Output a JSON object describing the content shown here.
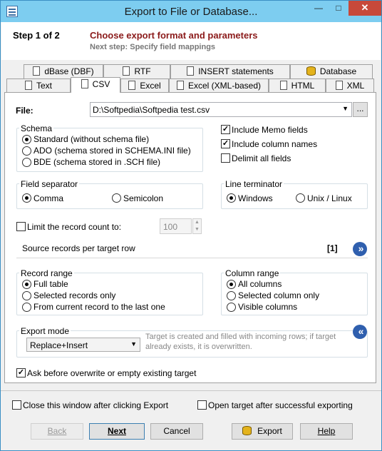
{
  "window": {
    "title": "Export to File or Database..."
  },
  "header": {
    "step": "Step 1 of 2",
    "title": "Choose export format and parameters",
    "next_step": "Next step: Specify field mappings"
  },
  "tabs_back": [
    {
      "label": "dBase (DBF)",
      "icon": "document-icon"
    },
    {
      "label": "RTF",
      "icon": "document-icon"
    },
    {
      "label": "INSERT statements",
      "icon": "document-icon"
    },
    {
      "label": "Database",
      "icon": "database-icon"
    }
  ],
  "tabs_front": [
    {
      "label": "Text",
      "icon": "document-icon"
    },
    {
      "label": "CSV",
      "icon": "document-icon",
      "selected": true
    },
    {
      "label": "Excel",
      "icon": "document-icon"
    },
    {
      "label": "Excel (XML-based)",
      "icon": "document-icon"
    },
    {
      "label": "HTML",
      "icon": "document-icon"
    },
    {
      "label": "XML",
      "icon": "document-icon"
    }
  ],
  "file": {
    "label": "File:",
    "value": "D:\\Softpedia\\Softpedia test.csv",
    "browse": "..."
  },
  "schema": {
    "title": "Schema",
    "options": [
      "Standard (without schema file)",
      "ADO (schema stored in SCHEMA.INI file)",
      "BDE (schema stored in .SCH file)"
    ],
    "selected": 0
  },
  "options": {
    "include_memo": "Include Memo fields",
    "include_columns": "Include column names",
    "delimit_all": "Delimit all fields"
  },
  "field_separator": {
    "title": "Field separator",
    "options": [
      "Comma",
      "Semicolon"
    ],
    "selected": 0
  },
  "line_terminator": {
    "title": "Line terminator",
    "options": [
      "Windows",
      "Unix / Linux"
    ],
    "selected": 0
  },
  "limit": {
    "label": "Limit the record count to:",
    "value": "100"
  },
  "source": {
    "label": "Source records per target row",
    "count": "[1]"
  },
  "record_range": {
    "title": "Record range",
    "options": [
      "Full table",
      "Selected records only",
      "From current record to the last one"
    ],
    "selected": 0
  },
  "column_range": {
    "title": "Column range",
    "options": [
      "All columns",
      "Selected column only",
      "Visible columns"
    ],
    "selected": 0
  },
  "export_mode": {
    "title": "Export mode",
    "value": "Replace+Insert",
    "note": "Target is created and filled with incoming rows; if target already exists, it is overwritten."
  },
  "ask_overwrite": "Ask before overwrite or empty existing target",
  "close_window": "Close this window after clicking Export",
  "open_target": "Open target after successful exporting",
  "buttons": {
    "back": "Back",
    "next": "Next",
    "cancel": "Cancel",
    "export": "Export",
    "help": "Help"
  },
  "colors": {
    "titlebar": "#7dcdf0",
    "header_title": "#8b1a1a",
    "nav_circle": "#2f5fae"
  }
}
